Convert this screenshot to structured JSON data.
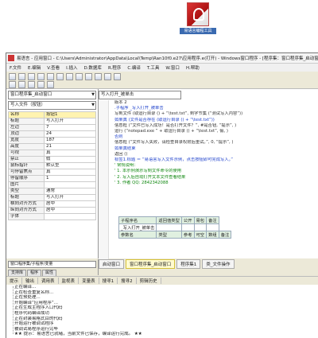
{
  "desktop": {
    "icon_label": "易语言编程工具"
  },
  "window": {
    "title": "易语言 - 应用窗口 - C:\\Users\\Administrator\\AppData\\Local\\Temp\\Ran10f0.e27\\应用程序.e(打开) - Windows窗口程序 - [程序集：窗口程序集_启动窗口]"
  },
  "menu": [
    "F.文件",
    "E.编辑",
    "V.查看",
    "I.插入",
    "D.数据库",
    "R.程序",
    "C.编译",
    "T.工具",
    "W.窗口",
    "H.帮助"
  ],
  "left": {
    "object_select": "窗口程序集_启动窗口",
    "prop_select": "写入文件（按钮）",
    "props": [
      {
        "k": "名称",
        "v": "按钮1"
      },
      {
        "k": "标题",
        "v": "写入打开"
      },
      {
        "k": "左边",
        "v": "7"
      },
      {
        "k": "顶边",
        "v": "24"
      },
      {
        "k": "宽度",
        "v": "187"
      },
      {
        "k": "高度",
        "v": "21"
      },
      {
        "k": "可视",
        "v": "真"
      },
      {
        "k": "禁止",
        "v": "假"
      },
      {
        "k": "鼠标指针",
        "v": "默认型"
      },
      {
        "k": "可停留焦点",
        "v": "真"
      },
      {
        "k": "停留顺序",
        "v": "1"
      },
      {
        "k": "图片",
        "v": ""
      },
      {
        "k": "类型",
        "v": "通常"
      },
      {
        "k": "标题",
        "v": "写入打开"
      },
      {
        "k": "横向对齐方式",
        "v": "居中"
      },
      {
        "k": "纵向对齐方式",
        "v": "居中"
      },
      {
        "k": "字体",
        "v": ""
      }
    ],
    "bottom_select": "窗口程序集/子程序/变量",
    "bottom_tabs": [
      "支持库",
      "程序",
      "属性"
    ]
  },
  "editor": {
    "combo": "写入打开_被单击",
    "lines": [
      {
        "t": "版本 2",
        "c": "c-dk"
      },
      {
        "t": ".子程序 _写入打开_被单击",
        "c": "c-blue"
      },
      {
        "t": "写到文件 (取运行目录 () + “\\test.txt”, 到字节集 (“测试写入内容”))",
        "c": "c-dk"
      },
      {
        "t": "如果真 (文件是否存在 (取运行目录 () + “\\test.txt”))",
        "c": "c-blue"
      },
      {
        "t": "    信息框 (“文件已写入成功！是否打开文件？”, #是否钮, “提示”, )",
        "c": "c-dk"
      },
      {
        "t": "    运行 (“notepad.exe ” + 取运行目录 () + “\\test.txt”, 假, )",
        "c": "c-dk"
      },
      {
        "t": "否则",
        "c": "c-blue"
      },
      {
        "t": "    信息框 (“文件写入失败，请检查目录权限后重试。”, 0, “提示”, )",
        "c": "c-dk"
      },
      {
        "t": "如果真结束",
        "c": "c-blue"
      },
      {
        "t": "返回 ()",
        "c": "c-dk"
      },
      {
        "t": "",
        "c": "c-dk"
      },
      {
        "t": "标签1.标题 ＝ “易语言写入文件示例，点击按钮即可完成写入。”",
        "c": "c-blue"
      },
      {
        "t": "",
        "c": "c-dk"
      },
      {
        "t": "' 常规说明：",
        "c": "c-green"
      },
      {
        "t": "' 1. 本示例演示写到文件命令的使用",
        "c": "c-green"
      },
      {
        "t": "' 2. 写入后自动打开文本文件查看结果",
        "c": "c-green"
      },
      {
        "t": "' 3. 作者 QQ: 2842342088",
        "c": "c-green"
      }
    ],
    "table_header": [
      "子程序名",
      "返回值类型",
      "公开",
      "易包",
      "备注"
    ],
    "table_row": [
      "_写入打开_被单击",
      "",
      "",
      "",
      ""
    ],
    "table_header2": [
      "参数名",
      "类型",
      "参考",
      "可空",
      "数组",
      "备注"
    ],
    "tabs": [
      "启动窗口",
      "窗口程序集_启动窗口",
      "程序集1",
      "类_文件操作"
    ]
  },
  "output": {
    "tabs": [
      "提示",
      "输出",
      "调用表",
      "监视表",
      "变量表",
      "搜寻1",
      "搜寻2",
      "剪辑历史"
    ],
    "lines": [
      "正在编译...",
      "正在检查重复名称...",
      "正在预处理...",
      "开始编译“应用程序”...",
      "正在生成主程序入口代码",
      "程序代码编译成功",
      "正在封装易格式目的代码",
      "开始运行被调试程序",
      "被调试易程序运行完毕",
      "★★ 提示：易语言已就绪，当前文件已保存，编译运行完成。 ★★"
    ]
  }
}
